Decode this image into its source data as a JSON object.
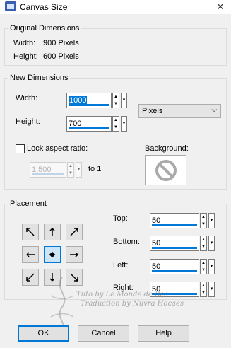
{
  "window": {
    "title": "Canvas Size",
    "close_glyph": "✕"
  },
  "original": {
    "legend": "Original Dimensions",
    "width_label": "Width:",
    "width_value": "900 Pixels",
    "height_label": "Height:",
    "height_value": "600 Pixels"
  },
  "new_dims": {
    "legend": "New Dimensions",
    "width_label": "Width:",
    "width_value": "1000",
    "height_label": "Height:",
    "height_value": "700",
    "units_selected": "Pixels",
    "lock_label": "Lock aspect ratio:",
    "lock_checked": false,
    "ratio_value": "1,500",
    "ratio_suffix": "to 1",
    "background_label": "Background:"
  },
  "placement": {
    "legend": "Placement",
    "selected": "center",
    "top_label": "Top:",
    "top_value": "50",
    "bottom_label": "Bottom:",
    "bottom_value": "50",
    "left_label": "Left:",
    "left_value": "50",
    "right_label": "Right:",
    "right_value": "50"
  },
  "buttons": {
    "ok": "OK",
    "cancel": "Cancel",
    "help": "Help"
  },
  "watermark": {
    "line1": "Tuto by Le Monde de Bea",
    "line2": "Traduction by Nuvra Hocaes"
  },
  "colors": {
    "accent": "#0078d7",
    "window_bg": "#f0f0f0"
  }
}
